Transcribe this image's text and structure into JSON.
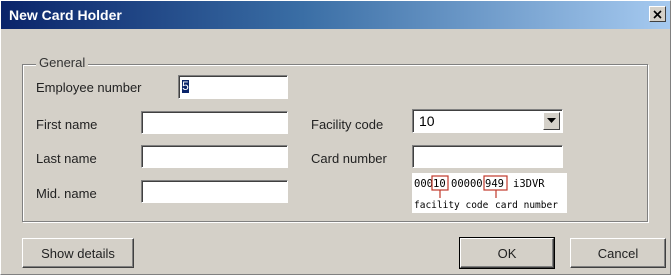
{
  "window": {
    "title": "New Card Holder"
  },
  "group": {
    "label": "General"
  },
  "fields": {
    "employee_number": {
      "label": "Employee number",
      "value": "5"
    },
    "first_name": {
      "label": "First name",
      "value": ""
    },
    "last_name": {
      "label": "Last name",
      "value": ""
    },
    "mid_name": {
      "label": "Mid. name",
      "value": ""
    },
    "facility_code": {
      "label": "Facility code",
      "value": "10"
    },
    "card_number": {
      "label": "Card number",
      "value": ""
    }
  },
  "card_example": {
    "prefix": "000",
    "facility": "10",
    "middle": "00000",
    "card": "949",
    "suffix": "i3DVR",
    "facility_caption": "facility code",
    "card_caption": "card number"
  },
  "buttons": {
    "show_details": "Show details",
    "ok": "OK",
    "cancel": "Cancel"
  },
  "icons": {
    "close": "close-icon",
    "dropdown": "chevron-down-icon"
  },
  "colors": {
    "titlebar_start": "#0a246a",
    "titlebar_end": "#a6caf0",
    "dialog_bg": "#d4d0c8",
    "highlight_box": "#c0392b"
  }
}
